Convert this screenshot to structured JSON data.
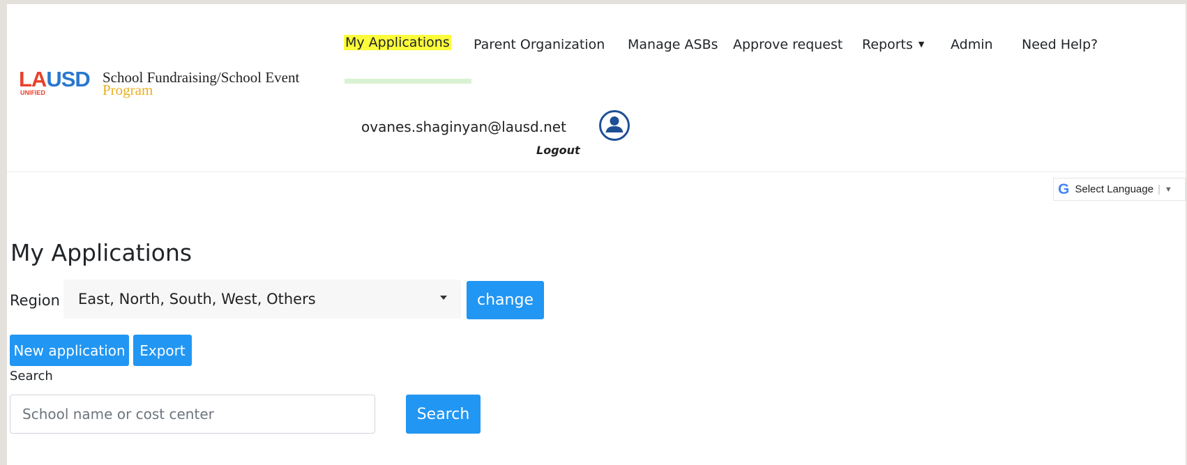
{
  "brand": {
    "logo_la": "LA",
    "logo_usd": "USD",
    "logo_unified": "UNIFIED",
    "program_title": "School Fundraising/School Event",
    "program_sub": "Program"
  },
  "nav": {
    "items": [
      {
        "label": "My Applications",
        "active": true
      },
      {
        "label": "Parent Organization"
      },
      {
        "label": "Manage ASBs"
      },
      {
        "label": "Approve request"
      },
      {
        "label": "Reports"
      },
      {
        "label": "Admin"
      },
      {
        "label": "Need Help?"
      }
    ]
  },
  "user": {
    "email": "ovanes.shaginyan@lausd.net",
    "logout_label": "Logout",
    "avatar_icon": "user-circle-icon"
  },
  "translate": {
    "logo": "G",
    "label": "Select Language",
    "separator": "|",
    "arrow": "▼"
  },
  "page": {
    "title": "My Applications"
  },
  "region": {
    "label": "Region",
    "selected": "East, North, South, West, Others",
    "change_label": "change"
  },
  "actions": {
    "new_application_label": "New application",
    "export_label": "Export"
  },
  "search": {
    "label": "Search",
    "placeholder": "School name or cost center",
    "value": "",
    "button_label": "Search"
  },
  "colors": {
    "primary_button": "#2196f3",
    "active_highlight": "#fdfc3a",
    "logo_red": "#e8412c",
    "logo_blue": "#2a78cf",
    "program_gold": "#e9b020"
  }
}
